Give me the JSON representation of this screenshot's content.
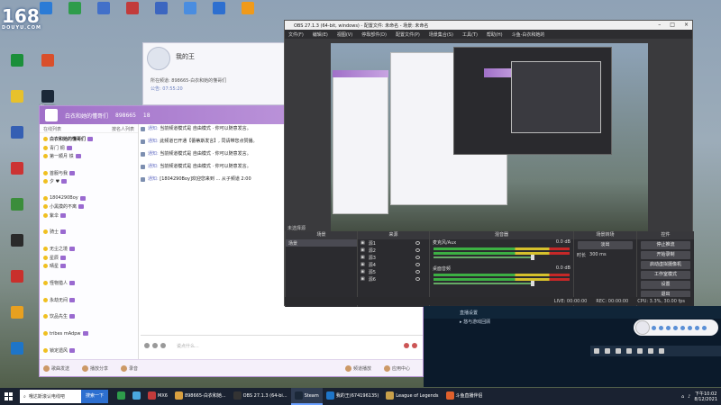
{
  "desktop": {
    "logo": {
      "big": "168",
      "small": "DOUYU.COM"
    },
    "icons": [
      {
        "label": "",
        "color": "#2b7bd6"
      },
      {
        "label": "",
        "color": "#2e9c4b"
      },
      {
        "label": "",
        "color": "#4270c9"
      },
      {
        "label": "",
        "color": "#c23b3b"
      },
      {
        "label": "",
        "color": "#3c66c0"
      },
      {
        "label": "",
        "color": "#4a8de0"
      },
      {
        "label": "",
        "color": "#2d6fd0"
      },
      {
        "label": "",
        "color": "#f09a1a"
      },
      {
        "label": "",
        "color": "#1b8f3a"
      },
      {
        "label": "",
        "color": "#e7c12c"
      },
      {
        "label": "",
        "color": "#355fb3"
      },
      {
        "label": "",
        "color": "#cc3333"
      },
      {
        "label": "",
        "color": "#3b8d3b"
      },
      {
        "label": "",
        "color": "#2a2a2a"
      },
      {
        "label": "",
        "color": "#c9302c"
      },
      {
        "label": "",
        "color": "#e8a020"
      },
      {
        "label": "",
        "color": "#1e75c8"
      },
      {
        "label": "",
        "color": "#d94f2b"
      },
      {
        "label": "Steam",
        "color": "#1b2838"
      },
      {
        "label": "",
        "color": "#3a5b9a"
      },
      {
        "label": "",
        "color": "#2d6fd0"
      },
      {
        "label": "",
        "color": "#b72e2e"
      },
      {
        "label": "",
        "color": "#2a4f8a"
      },
      {
        "label": "",
        "color": "#e0a030"
      }
    ]
  },
  "qq_window": {
    "name": "我的王",
    "line1": "所在频道: 898665-白衣和她的懂哥们",
    "line2": "公告: 07:55:20"
  },
  "room": {
    "title": "白衣和她的懂哥们",
    "room_id": "898665",
    "online": "18",
    "list_header_left": "在线列表",
    "list_header_right": "按名人列表",
    "users": [
      {
        "name": "白衣和她的懂哥们",
        "group": true
      },
      {
        "name": "青门 铜",
        "group": false
      },
      {
        "name": "第一顺月 铁",
        "group": false
      },
      {
        "name": "",
        "group": false
      },
      {
        "name": "首服与我",
        "group": false
      },
      {
        "name": "夕 ♥",
        "group": false
      },
      {
        "name": "",
        "group": false
      },
      {
        "name": "1804290Boy",
        "group": false
      },
      {
        "name": "小黑摸的不离",
        "group": false
      },
      {
        "name": "紫伞",
        "group": false
      },
      {
        "name": "",
        "group": false
      },
      {
        "name": "骑士",
        "group": false
      },
      {
        "name": "",
        "group": false
      },
      {
        "name": "无尘之境",
        "group": false
      },
      {
        "name": "星辰",
        "group": false
      },
      {
        "name": "晴星",
        "group": false
      },
      {
        "name": "",
        "group": false
      },
      {
        "name": "怪物猎人",
        "group": false
      },
      {
        "name": "",
        "group": false
      },
      {
        "name": "永劫无间",
        "group": false
      },
      {
        "name": "",
        "group": false
      },
      {
        "name": "饮品先生",
        "group": false
      },
      {
        "name": "",
        "group": false
      },
      {
        "name": "tribes mAdpw",
        "group": false
      },
      {
        "name": "",
        "group": false
      },
      {
        "name": "锁定遗风",
        "group": false
      }
    ],
    "messages": [
      {
        "prefix": "通知:",
        "text": "当前频道模式是 自由模式 · 你可以随意发言。"
      },
      {
        "prefix": "通知:",
        "text": "此频道已开通【蕾蒂斯发言】, 同请带您点赞播。"
      },
      {
        "prefix": "通知:",
        "text": "当前频道模式是 自由模式 · 你可以随意发言。"
      },
      {
        "prefix": "通知:",
        "text": "当前频道模式是 自由模式 · 你可以随意发言。"
      },
      {
        "prefix": "通知:",
        "text": "[1804290Boy]欢迎您来到 ... 从子频道 2:00"
      }
    ],
    "gift_text": "直播你的号",
    "input_placeholder": "说点什么...",
    "footer": {
      "btn1": "歌曲发送",
      "btn2": "播放分享",
      "btn3": "录音",
      "right1": "频道播放",
      "right2": "应用中心"
    }
  },
  "obs": {
    "title": "OBS 27.1.3 (64-bit, windows) - 配置文件: 未命名 - 场景: 未命名",
    "menu": [
      "文件(F)",
      "编辑(E)",
      "视图(V)",
      "停靠部件(D)",
      "配置文件(P)",
      "场景集合(S)",
      "工具(T)",
      "帮助(H)",
      "斗鱼-白衣和她的"
    ],
    "preview_label": "未选择源",
    "scenes_title": "场景",
    "scenes": [
      "场景"
    ],
    "sources_title": "来源",
    "sources": [
      "源1",
      "源2",
      "源3",
      "源4",
      "源5",
      "源6"
    ],
    "mixer_title": "混音器",
    "mixer": [
      {
        "name": "麦克风/Aux",
        "db": "0.0 dB"
      },
      {
        "name": "桌面音频",
        "db": "0.0 dB"
      }
    ],
    "transition_title": "场景转场",
    "transition": {
      "type": "淡出",
      "duration_label": "时长",
      "duration": "300 ms"
    },
    "controls_title": "控件",
    "controls": [
      "停止推流",
      "开始录制",
      "启动虚拟摄像机",
      "工作室模式",
      "设置",
      "退出"
    ],
    "status": [
      "LIVE: 00:00:00",
      "REC: 00:00:00",
      "CPU: 3.3%, 30.00 fps"
    ]
  },
  "game_bg": {
    "bar": "直播设置",
    "option": "▸ 悠与游戏回顾"
  },
  "taskbar": {
    "search_text": "哦达斯滚认电线吧",
    "search_btn": "搜索一下",
    "apps": [
      {
        "label": "",
        "color": "#2e9c4b",
        "active": false
      },
      {
        "label": "",
        "color": "#4aa8e0",
        "active": false
      },
      {
        "label": "MX6",
        "color": "#c23b3b",
        "active": false
      },
      {
        "label": "898665-白衣和她...",
        "color": "#d9a040",
        "active": false
      },
      {
        "label": "OBS 27.1.3 (64-bi...",
        "color": "#333333",
        "active": false
      },
      {
        "label": "Steam",
        "color": "#1b2838",
        "active": true
      },
      {
        "label": "我的王(674196135)",
        "color": "#1e75c8",
        "active": false
      },
      {
        "label": "League of Legends",
        "color": "#c9a04a",
        "active": false
      },
      {
        "label": "斗鱼直播伴侣",
        "color": "#e0602c",
        "active": false
      }
    ],
    "time": "下午10:02",
    "date": "8/12/2021"
  }
}
